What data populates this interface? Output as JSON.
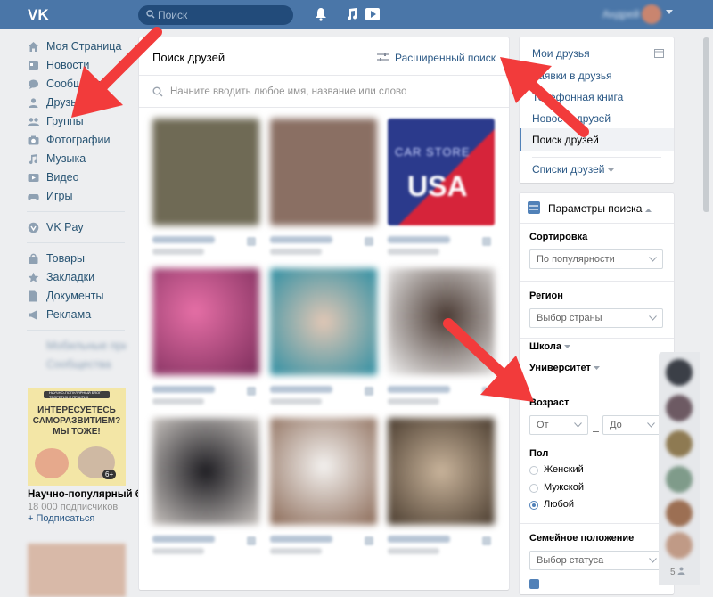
{
  "topbar": {
    "logo": "vk-logo",
    "search_placeholder": "Поиск",
    "user_name": "Андрей"
  },
  "leftnav": {
    "items": [
      {
        "label": "Моя Страница",
        "icon": "home-icon"
      },
      {
        "label": "Новости",
        "icon": "news-icon"
      },
      {
        "label": "Сообщения",
        "icon": "messages-icon"
      },
      {
        "label": "Друзья",
        "icon": "friends-icon"
      },
      {
        "label": "Группы",
        "icon": "groups-icon"
      },
      {
        "label": "Фотографии",
        "icon": "photos-icon"
      },
      {
        "label": "Музыка",
        "icon": "music-icon"
      },
      {
        "label": "Видео",
        "icon": "video-icon"
      },
      {
        "label": "Игры",
        "icon": "games-icon"
      }
    ],
    "vkpay": "VK Pay",
    "items2": [
      {
        "label": "Товары",
        "icon": "goods-icon"
      },
      {
        "label": "Закладки",
        "icon": "bookmarks-icon"
      },
      {
        "label": "Документы",
        "icon": "documents-icon"
      },
      {
        "label": "Реклама",
        "icon": "ads-icon"
      }
    ],
    "blurred": [
      "Мобильные приложения",
      "Сообщества"
    ]
  },
  "ad": {
    "banner_line1": "НАУЧНО-ПОПУЛЯРНЫЙ БЛОГ ТЕОРЕТИК И ПРАКТИК",
    "banner_text": "ИНТЕРЕСУЕТЕСЬ САМОРАЗВИТИЕМ? МЫ ТОЖЕ!",
    "age": "6+",
    "title": "Научно-популярный блог",
    "subscribers": "18 000 подписчиков",
    "follow": "+ Подписаться"
  },
  "main": {
    "title": "Поиск друзей",
    "advanced_search": "Расширенный поиск",
    "search_placeholder": "Начните вводить любое имя, название или слово",
    "cards": [
      {
        "photo": "#6f6a55"
      },
      {
        "photo": "#8a6f63"
      },
      {
        "photo": "#2f3c8f",
        "text": "CAR STORE USA"
      },
      {
        "photo": "#c84f86"
      },
      {
        "photo": "#3f8fa0"
      },
      {
        "photo": "#3a2f2c"
      },
      {
        "photo": "#2b2a2e"
      },
      {
        "photo": "#b7a79c"
      },
      {
        "photo": "#a68c70"
      }
    ]
  },
  "right_menu": {
    "items": [
      "Мои друзья",
      "Заявки в друзья",
      "Телефонная книга",
      "Новости друзей"
    ],
    "active": "Поиск друзей",
    "lists": "Списки друзей"
  },
  "params": {
    "title": "Параметры поиска",
    "sort_label": "Сортировка",
    "sort_value": "По популярности",
    "region_label": "Регион",
    "region_value": "Выбор страны",
    "school_label": "Школа",
    "university_label": "Университет",
    "age_label": "Возраст",
    "age_from": "От",
    "age_to": "До",
    "sex_label": "Пол",
    "sex_options": [
      "Женский",
      "Мужской",
      "Любой"
    ],
    "sex_selected": "Любой",
    "family_label": "Семейное положение",
    "family_value": "Выбор статуса"
  },
  "chat": {
    "count": "5"
  },
  "colors": {
    "topbar": "#4a76a8",
    "link": "#2a5885",
    "arrow": "#f23b3b",
    "accent": "#5181b8"
  }
}
